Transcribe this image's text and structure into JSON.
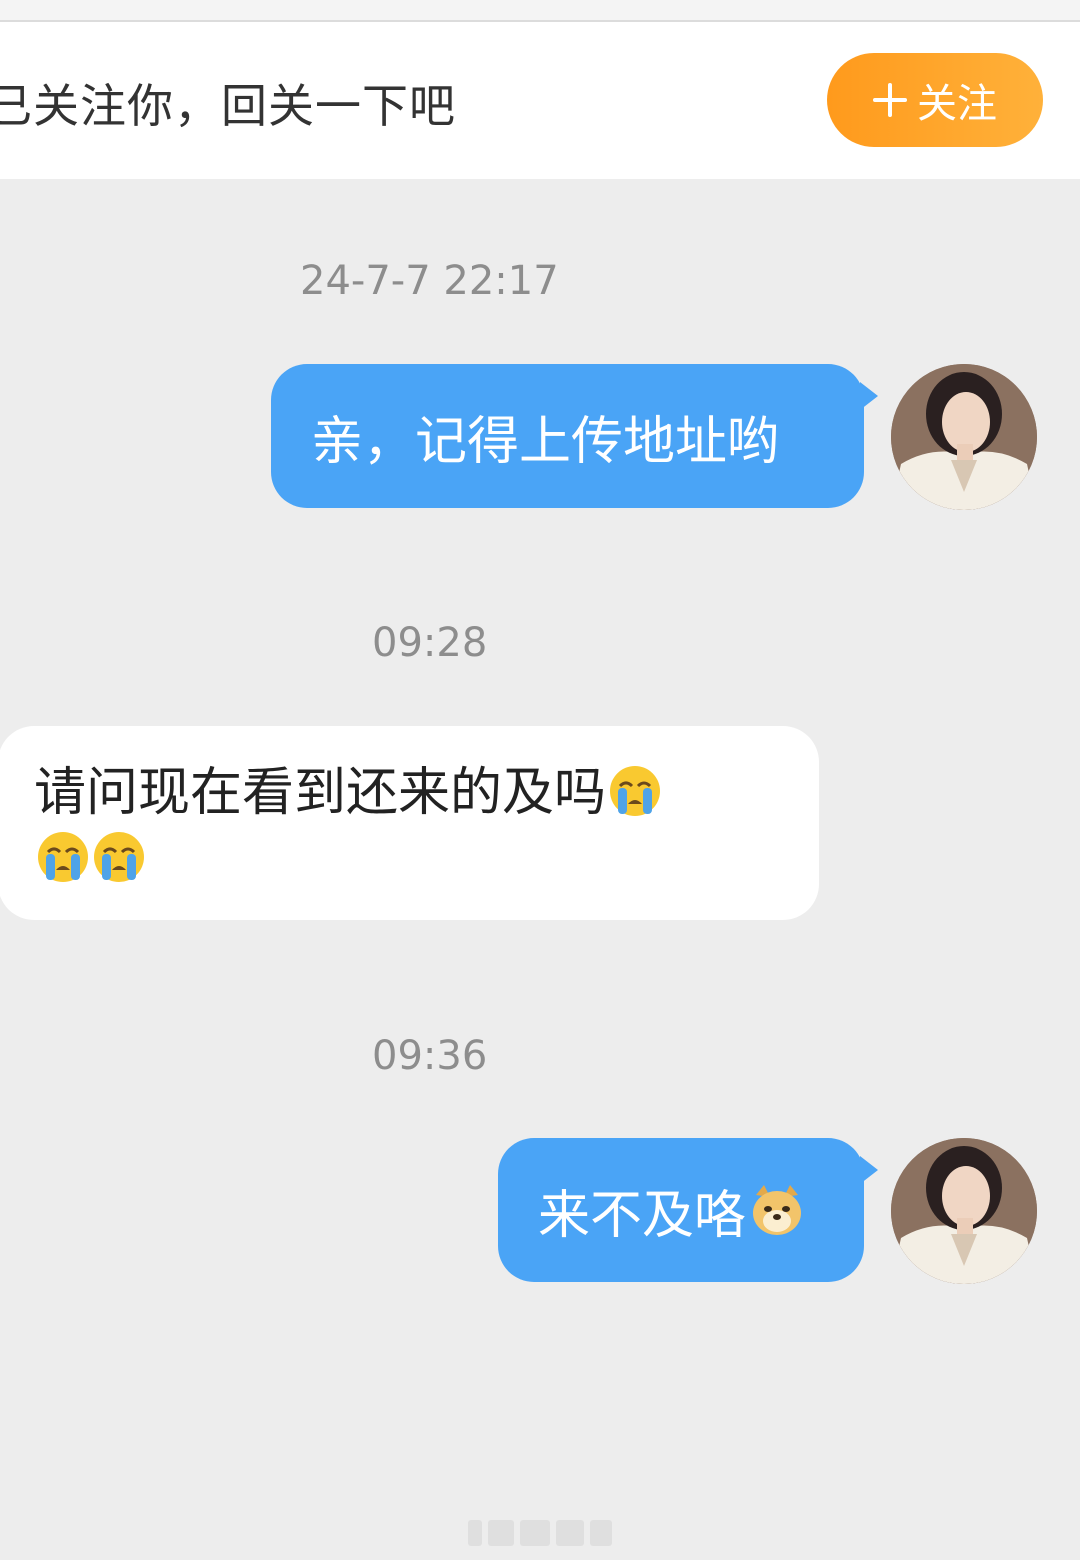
{
  "follow_banner": {
    "text": "已关注你，回关一下吧",
    "button_label": "关注"
  },
  "messages": [
    {
      "timestamp": "24-7-7 22:17",
      "direction": "outgoing",
      "text": "亲，记得上传地址哟"
    },
    {
      "timestamp": "09:28",
      "direction": "incoming",
      "text": "请问现在看到还来的及吗",
      "emoji": [
        "crying-emoji",
        "crying-emoji",
        "crying-emoji"
      ]
    },
    {
      "timestamp": "09:36",
      "direction": "outgoing",
      "text": "来不及咯",
      "emoji": [
        "doge-emoji"
      ]
    }
  ],
  "colors": {
    "outgoing_bubble": "#4aa4f6",
    "incoming_bubble": "#ffffff",
    "follow_button": "#ff9a1c",
    "background": "#ededed"
  }
}
